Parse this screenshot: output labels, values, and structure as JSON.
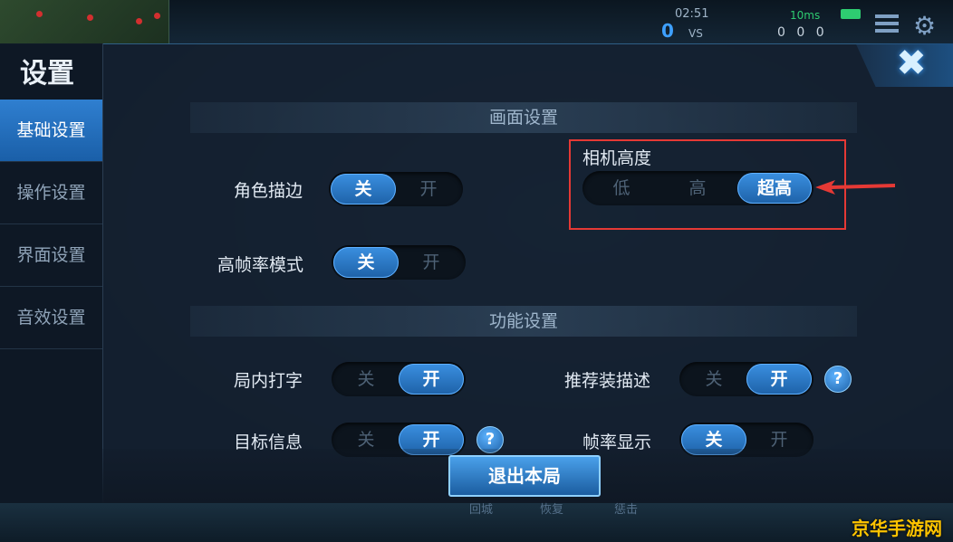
{
  "hud": {
    "time": "02:51",
    "score_left": "0",
    "vs": "VS",
    "ping": "10ms",
    "kda": "0 0 0"
  },
  "sidebar": {
    "title": "设置",
    "items": [
      {
        "label": "基础设置",
        "active": true
      },
      {
        "label": "操作设置",
        "active": false
      },
      {
        "label": "界面设置",
        "active": false
      },
      {
        "label": "音效设置",
        "active": false
      }
    ]
  },
  "sections": {
    "display": "画面设置",
    "function": "功能设置"
  },
  "settings": {
    "outline": {
      "label": "角色描边",
      "off": "关",
      "on": "开",
      "value": "关"
    },
    "high_fps": {
      "label": "高帧率模式",
      "off": "关",
      "on": "开",
      "value": "关"
    },
    "camera": {
      "label": "相机高度",
      "options": [
        "低",
        "高",
        "超高"
      ],
      "value": "超高"
    },
    "typing": {
      "label": "局内打字",
      "off": "关",
      "on": "开",
      "value": "开"
    },
    "target_info": {
      "label": "目标信息",
      "off": "关",
      "on": "开",
      "value": "开"
    },
    "recommend_desc": {
      "label": "推荐装描述",
      "off": "关",
      "on": "开",
      "value": "开"
    },
    "fps_display": {
      "label": "帧率显示",
      "off": "关",
      "on": "开",
      "value": "关"
    }
  },
  "help_glyph": "?",
  "close_glyph": "✖",
  "exit_button": "退出本局",
  "bottom_ghost": [
    "回城",
    "恢复",
    "惩击"
  ],
  "watermark": "京华手游网",
  "colors": {
    "accent": "#2f7fd0",
    "highlight_box": "#e53935",
    "watermark": "#ffc400"
  }
}
